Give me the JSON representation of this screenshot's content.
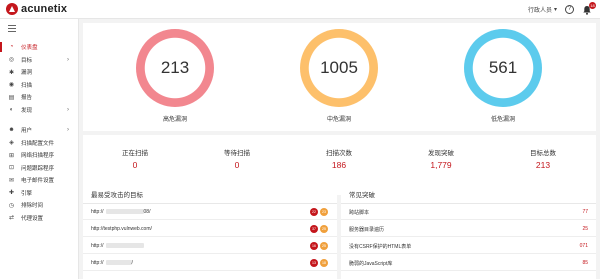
{
  "app": {
    "logo_text": "acunetix"
  },
  "header": {
    "user_label": "行政人员",
    "help": "?",
    "notifications": "18"
  },
  "sidebar": {
    "items": [
      {
        "label": "仪表盘",
        "icon": "dashboard-icon",
        "active": true
      },
      {
        "label": "目标",
        "icon": "target-icon",
        "has_children": true
      },
      {
        "label": "漏洞",
        "icon": "bug-icon"
      },
      {
        "label": "扫描",
        "icon": "scan-icon"
      },
      {
        "label": "报告",
        "icon": "report-icon"
      },
      {
        "label": "发现",
        "icon": "discover-icon",
        "has_children": true
      },
      {
        "label": "用户",
        "icon": "users-icon",
        "has_children": true
      },
      {
        "label": "扫描配置文件",
        "icon": "scan-profile-icon"
      },
      {
        "label": "网络扫描程序",
        "icon": "network-scanner-icon"
      },
      {
        "label": "问题跟踪程序",
        "icon": "issue-tracker-icon"
      },
      {
        "label": "电子邮件设置",
        "icon": "email-icon"
      },
      {
        "label": "引擎",
        "icon": "engine-icon"
      },
      {
        "label": "排除时间",
        "icon": "clock-icon"
      },
      {
        "label": "代理设置",
        "icon": "proxy-icon"
      }
    ]
  },
  "severity": {
    "high": {
      "value": "213",
      "label": "高危漏洞"
    },
    "medium": {
      "value": "1005",
      "label": "中危漏洞"
    },
    "low": {
      "value": "561",
      "label": "低危漏洞"
    }
  },
  "colors": {
    "high": "#f2878f",
    "medium": "#fdc06b",
    "low": "#5ccbed",
    "accent": "#c4161c"
  },
  "counts": [
    {
      "label": "正在扫描",
      "value": "0"
    },
    {
      "label": "等待扫描",
      "value": "0"
    },
    {
      "label": "扫描次数",
      "value": "186"
    },
    {
      "label": "发现突破",
      "value": "1,779"
    },
    {
      "label": "目标总数",
      "value": "213"
    }
  ],
  "targets": {
    "title": "最易受攻击的目标",
    "rows": [
      {
        "prefix": "http://",
        "suffix": "08/",
        "high": "22",
        "medium": "23"
      },
      {
        "prefix": "http://testphp.vulnweb.com/",
        "suffix": "",
        "high": "37",
        "medium": "25"
      },
      {
        "prefix": "http://",
        "suffix": "",
        "high": "16",
        "medium": "25"
      },
      {
        "prefix": "http://",
        "suffix": "/",
        "high": "13",
        "medium": "18"
      }
    ]
  },
  "vulns": {
    "title": "常见突破",
    "rows": [
      {
        "name": "跨站脚本",
        "count": "77"
      },
      {
        "name": "服务器目录遍历",
        "count": "25"
      },
      {
        "name": "没有CSRF保护的HTML表单",
        "count": "071"
      },
      {
        "name": "脆弱的JavaScript库",
        "count": "85"
      }
    ]
  }
}
